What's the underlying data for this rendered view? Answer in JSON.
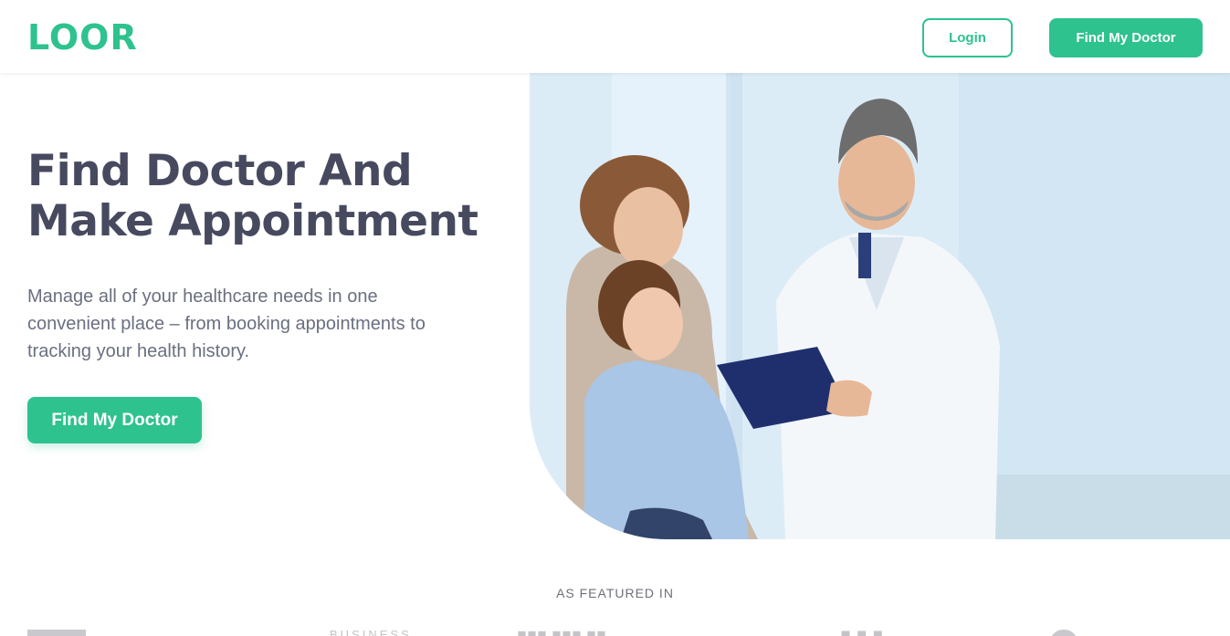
{
  "colors": {
    "brand_green": "#2ec28e",
    "heading": "#474a5f",
    "body_text": "#6a6f80"
  },
  "header": {
    "logo": "LOOR",
    "login_label": "Login",
    "find_doctor_label": "Find My Doctor"
  },
  "hero": {
    "title_line1": "Find Doctor And",
    "title_line2": "Make Appointment",
    "description": "Manage all of your healthcare needs in one convenient place – from booking appointments to tracking your health history.",
    "cta_label": "Find My Doctor",
    "image_icon": "doctor-with-family-photo"
  },
  "featured": {
    "label": "AS FEATURED IN",
    "brands_partial": [
      "BUSINESS"
    ]
  }
}
